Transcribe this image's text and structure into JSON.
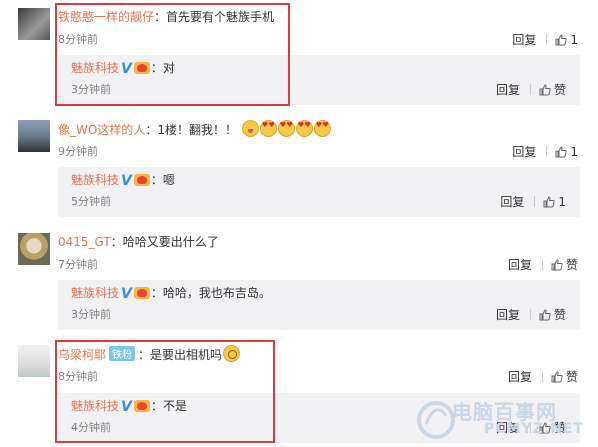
{
  "comments": [
    {
      "username": "铁憨憨一样的靓仔",
      "text": "：首先要有个魅族手机",
      "time": "8分钟前",
      "reply_label": "回复",
      "like_label": "1",
      "reply": {
        "username": "魅族科技",
        "text": "：对",
        "time": "3分钟前",
        "reply_label": "回复",
        "like_label": "赞"
      }
    },
    {
      "username": "像_WO这样的人",
      "text": "：1楼！翻我！！",
      "time": "9分钟前",
      "reply_label": "回复",
      "like_label": "1",
      "reply": {
        "username": "魅族科技",
        "text": "：嗯",
        "time": "5分钟前",
        "reply_label": "回复",
        "like_label": "1"
      }
    },
    {
      "username": "0415_GT",
      "text": "：哈哈又要出什么了",
      "time": "7分钟前",
      "reply_label": "回复",
      "like_label": "赞",
      "reply": {
        "username": "魅族科技",
        "text": "：哈哈，我也布吉岛。",
        "time": "3分钟前",
        "reply_label": "回复",
        "like_label": "赞"
      }
    },
    {
      "username": "乌梁柯耶",
      "badge": "铁粉",
      "text": "：是要出相机吗",
      "time": "8分钟前",
      "reply_label": "回复",
      "like_label": "赞",
      "reply": {
        "username": "魅族科技",
        "text": "：不是",
        "time": "4分钟前",
        "reply_label": "回复",
        "like_label": "赞"
      }
    }
  ],
  "verified_mark": "V",
  "watermark": {
    "title": "电脑百事网",
    "url": "PCMYZ.NET"
  },
  "colors": {
    "username": "#eb7350",
    "highlight": "#e03a3a",
    "reply_bg": "#f2f2f5"
  }
}
